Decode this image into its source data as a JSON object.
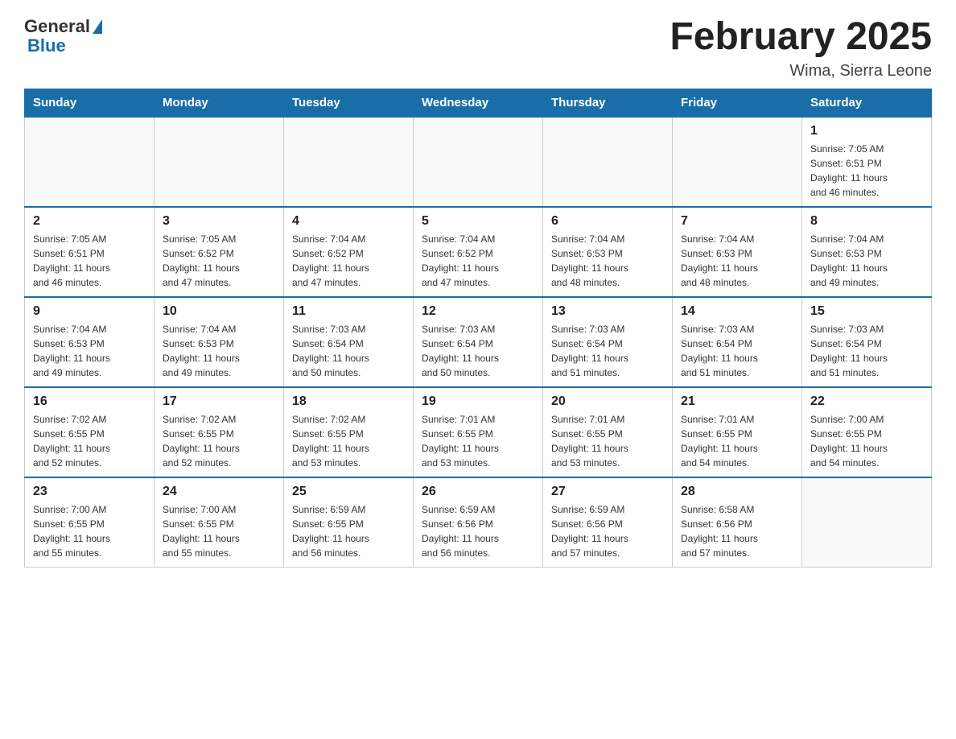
{
  "logo": {
    "general_text": "General",
    "blue_text": "Blue"
  },
  "header": {
    "title": "February 2025",
    "location": "Wima, Sierra Leone"
  },
  "weekdays": [
    "Sunday",
    "Monday",
    "Tuesday",
    "Wednesday",
    "Thursday",
    "Friday",
    "Saturday"
  ],
  "weeks": [
    [
      {
        "day": "",
        "info": ""
      },
      {
        "day": "",
        "info": ""
      },
      {
        "day": "",
        "info": ""
      },
      {
        "day": "",
        "info": ""
      },
      {
        "day": "",
        "info": ""
      },
      {
        "day": "",
        "info": ""
      },
      {
        "day": "1",
        "info": "Sunrise: 7:05 AM\nSunset: 6:51 PM\nDaylight: 11 hours\nand 46 minutes."
      }
    ],
    [
      {
        "day": "2",
        "info": "Sunrise: 7:05 AM\nSunset: 6:51 PM\nDaylight: 11 hours\nand 46 minutes."
      },
      {
        "day": "3",
        "info": "Sunrise: 7:05 AM\nSunset: 6:52 PM\nDaylight: 11 hours\nand 47 minutes."
      },
      {
        "day": "4",
        "info": "Sunrise: 7:04 AM\nSunset: 6:52 PM\nDaylight: 11 hours\nand 47 minutes."
      },
      {
        "day": "5",
        "info": "Sunrise: 7:04 AM\nSunset: 6:52 PM\nDaylight: 11 hours\nand 47 minutes."
      },
      {
        "day": "6",
        "info": "Sunrise: 7:04 AM\nSunset: 6:53 PM\nDaylight: 11 hours\nand 48 minutes."
      },
      {
        "day": "7",
        "info": "Sunrise: 7:04 AM\nSunset: 6:53 PM\nDaylight: 11 hours\nand 48 minutes."
      },
      {
        "day": "8",
        "info": "Sunrise: 7:04 AM\nSunset: 6:53 PM\nDaylight: 11 hours\nand 49 minutes."
      }
    ],
    [
      {
        "day": "9",
        "info": "Sunrise: 7:04 AM\nSunset: 6:53 PM\nDaylight: 11 hours\nand 49 minutes."
      },
      {
        "day": "10",
        "info": "Sunrise: 7:04 AM\nSunset: 6:53 PM\nDaylight: 11 hours\nand 49 minutes."
      },
      {
        "day": "11",
        "info": "Sunrise: 7:03 AM\nSunset: 6:54 PM\nDaylight: 11 hours\nand 50 minutes."
      },
      {
        "day": "12",
        "info": "Sunrise: 7:03 AM\nSunset: 6:54 PM\nDaylight: 11 hours\nand 50 minutes."
      },
      {
        "day": "13",
        "info": "Sunrise: 7:03 AM\nSunset: 6:54 PM\nDaylight: 11 hours\nand 51 minutes."
      },
      {
        "day": "14",
        "info": "Sunrise: 7:03 AM\nSunset: 6:54 PM\nDaylight: 11 hours\nand 51 minutes."
      },
      {
        "day": "15",
        "info": "Sunrise: 7:03 AM\nSunset: 6:54 PM\nDaylight: 11 hours\nand 51 minutes."
      }
    ],
    [
      {
        "day": "16",
        "info": "Sunrise: 7:02 AM\nSunset: 6:55 PM\nDaylight: 11 hours\nand 52 minutes."
      },
      {
        "day": "17",
        "info": "Sunrise: 7:02 AM\nSunset: 6:55 PM\nDaylight: 11 hours\nand 52 minutes."
      },
      {
        "day": "18",
        "info": "Sunrise: 7:02 AM\nSunset: 6:55 PM\nDaylight: 11 hours\nand 53 minutes."
      },
      {
        "day": "19",
        "info": "Sunrise: 7:01 AM\nSunset: 6:55 PM\nDaylight: 11 hours\nand 53 minutes."
      },
      {
        "day": "20",
        "info": "Sunrise: 7:01 AM\nSunset: 6:55 PM\nDaylight: 11 hours\nand 53 minutes."
      },
      {
        "day": "21",
        "info": "Sunrise: 7:01 AM\nSunset: 6:55 PM\nDaylight: 11 hours\nand 54 minutes."
      },
      {
        "day": "22",
        "info": "Sunrise: 7:00 AM\nSunset: 6:55 PM\nDaylight: 11 hours\nand 54 minutes."
      }
    ],
    [
      {
        "day": "23",
        "info": "Sunrise: 7:00 AM\nSunset: 6:55 PM\nDaylight: 11 hours\nand 55 minutes."
      },
      {
        "day": "24",
        "info": "Sunrise: 7:00 AM\nSunset: 6:55 PM\nDaylight: 11 hours\nand 55 minutes."
      },
      {
        "day": "25",
        "info": "Sunrise: 6:59 AM\nSunset: 6:55 PM\nDaylight: 11 hours\nand 56 minutes."
      },
      {
        "day": "26",
        "info": "Sunrise: 6:59 AM\nSunset: 6:56 PM\nDaylight: 11 hours\nand 56 minutes."
      },
      {
        "day": "27",
        "info": "Sunrise: 6:59 AM\nSunset: 6:56 PM\nDaylight: 11 hours\nand 57 minutes."
      },
      {
        "day": "28",
        "info": "Sunrise: 6:58 AM\nSunset: 6:56 PM\nDaylight: 11 hours\nand 57 minutes."
      },
      {
        "day": "",
        "info": ""
      }
    ]
  ]
}
